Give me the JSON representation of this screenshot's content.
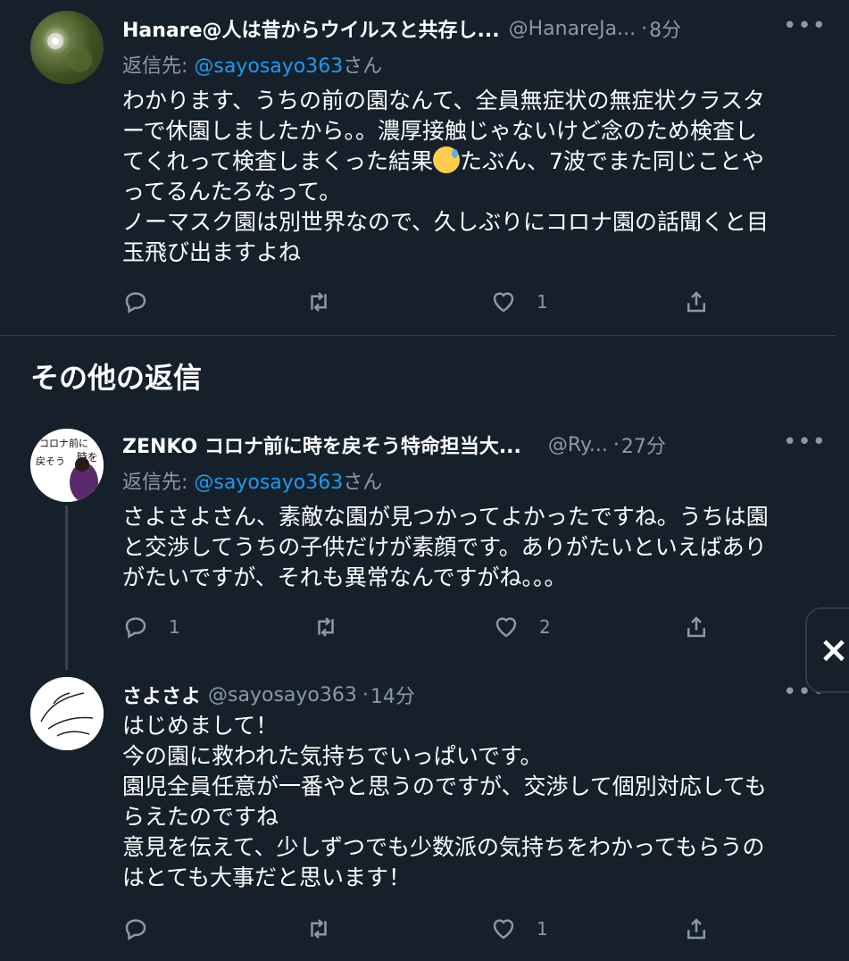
{
  "tweets": [
    {
      "name": "Hanare@人は昔からウイルスと共存し...",
      "handle": "@HanareJa...",
      "time": "8分",
      "reply_to_label": "返信先: ",
      "reply_to_mention": "@sayosayo363",
      "reply_to_suffix": "さん",
      "body_lines": [
        "わかります、うちの前の園なんて、全員無症状の無症状クラスタ",
        "ーで休園しましたから。。濃厚接触じゃないけど念のため検査し",
        "てくれって検査しまくった結果",
        "たぶん、7波でまた同じことや",
        "ってるんたろなって。",
        "ノーマスク園は別世界なので、久しぶりにコロナ園の話聞くと目",
        "玉飛び出ますよね"
      ],
      "emoji_icon": "grinning-face-with-sweat-icon",
      "reply_count": "",
      "retweet_count": "",
      "like_count": "1"
    },
    {
      "name": "ZENKO コロナ前に時を戻そう特命担当大...",
      "handle": "@Ry...",
      "time": "27分",
      "reply_to_label": "返信先: ",
      "reply_to_mention": "@sayosayo363",
      "reply_to_suffix": "さん",
      "body_lines": [
        "さよさよさん、素敵な園が見つかってよかったですね。うちは園",
        "と交渉してうちの子供だけが素顔です。ありがたいといえばあり",
        "がたいですが、それも異常なんですがね。。。"
      ],
      "avatar_text": [
        "コロナ前に",
        "戻そう",
        "時を"
      ],
      "reply_count": "1",
      "retweet_count": "",
      "like_count": "2"
    },
    {
      "name": "さよさよ",
      "handle": "@sayosayo363",
      "time": "14分",
      "body_lines": [
        "はじめまして！",
        "今の園に救われた気持ちでいっぱいです。",
        "園児全員任意が一番やと思うのですが、交渉して個別対応しても",
        "らえたのですね",
        "意見を伝えて、少しずつでも少数派の気持ちをわかってもらうの",
        "はとても大事だと思います！"
      ],
      "reply_count": "",
      "retweet_count": "",
      "like_count": "1"
    }
  ],
  "section_title": "その他の返信",
  "dot": "·",
  "more_label": "•••",
  "side_tab_label": "×",
  "colors": {
    "background": "#15202b",
    "secondary_text": "#8b98a5",
    "mention": "#1d9bf0",
    "divider": "#38444d"
  },
  "icons": [
    "reply-icon",
    "retweet-icon",
    "like-icon",
    "share-icon",
    "more-icon"
  ]
}
